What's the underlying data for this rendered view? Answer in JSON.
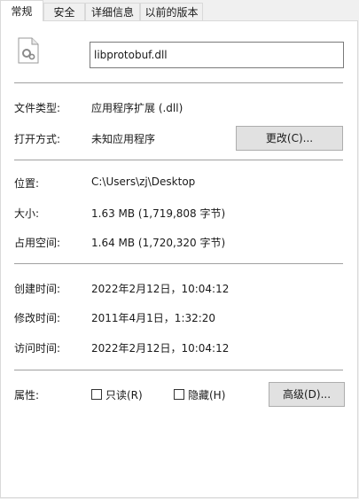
{
  "tabs": [
    "常规",
    "安全",
    "详细信息",
    "以前的版本"
  ],
  "file_name": "libprotobuf.dll",
  "rows": {
    "type_label": "文件类型:",
    "type_value": "应用程序扩展 (.dll)",
    "open_label": "打开方式:",
    "open_value": "未知应用程序",
    "change_button": "更改(C)...",
    "location_label": "位置:",
    "location_value": "C:\\Users\\zj\\Desktop",
    "size_label": "大小:",
    "size_value": "1.63 MB (1,719,808 字节)",
    "disk_label": "占用空间:",
    "disk_value": "1.64 MB (1,720,320 字节)",
    "created_label": "创建时间:",
    "created_value": "2022年2月12日，10:04:12",
    "modified_label": "修改时间:",
    "modified_value": "2011年4月1日，1:32:20",
    "accessed_label": "访问时间:",
    "accessed_value": "2022年2月12日，10:04:12",
    "attr_label": "属性:",
    "readonly_label": "只读(R)",
    "hidden_label": "隐藏(H)",
    "advanced_button": "高级(D)..."
  }
}
